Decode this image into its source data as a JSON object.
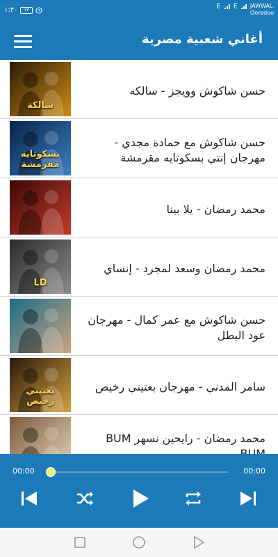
{
  "status_bar": {
    "time": "١:٣٠",
    "battery": "٧٣",
    "carrier_top": "JAWWAL",
    "carrier_bottom": "Ooredoo",
    "signal_1_tag": "E",
    "signal_2_tag": "E"
  },
  "app_bar": {
    "title": "أغاني شعبية مصرية",
    "menu_icon": "hamburger-menu-icon"
  },
  "songs": [
    {
      "title": "حسن شاكوش وويجز - سالكه",
      "thumb_text": "سالكة",
      "thumb_colors": [
        "#2a1c08",
        "#d08a16"
      ]
    },
    {
      "title": "حسن شاكوش مع حمادة مجدي - مهرجان إنتي بسكوتايه مقرمشة",
      "thumb_text": "بسكوتايه مقرمشة",
      "thumb_colors": [
        "#06244a",
        "#3d7fc2"
      ]
    },
    {
      "title": "محمد رمضان - يلا بينا",
      "thumb_text": "",
      "thumb_colors": [
        "#3c0808",
        "#c13c2a"
      ]
    },
    {
      "title": "محمد رمضان وسعد لمجرد - إنساي",
      "thumb_text": "LD",
      "thumb_colors": [
        "#2b2b2b",
        "#8a8a8a"
      ]
    },
    {
      "title": "حسن شاكوش مع عمر كمال - مهرجان عود البطل",
      "thumb_text": "",
      "thumb_colors": [
        "#1b6e8a",
        "#caa27d"
      ]
    },
    {
      "title": "سامر المدني - مهرجان بعتيني رخيص",
      "thumb_text": "بعتيني رخيص",
      "thumb_colors": [
        "#2a1a0c",
        "#d4a041"
      ]
    },
    {
      "title": "محمد رمضان - رايحين نسهر BUM BUM",
      "thumb_text": "",
      "thumb_colors": [
        "#7a5a3c",
        "#e7d3bb"
      ]
    }
  ],
  "player": {
    "current_time": "00:00",
    "total_time": "00:00",
    "progress": 0
  },
  "nav_bar": {
    "recent_icon": "square-icon",
    "home_icon": "circle-icon",
    "back_icon": "triangle-back-icon"
  }
}
